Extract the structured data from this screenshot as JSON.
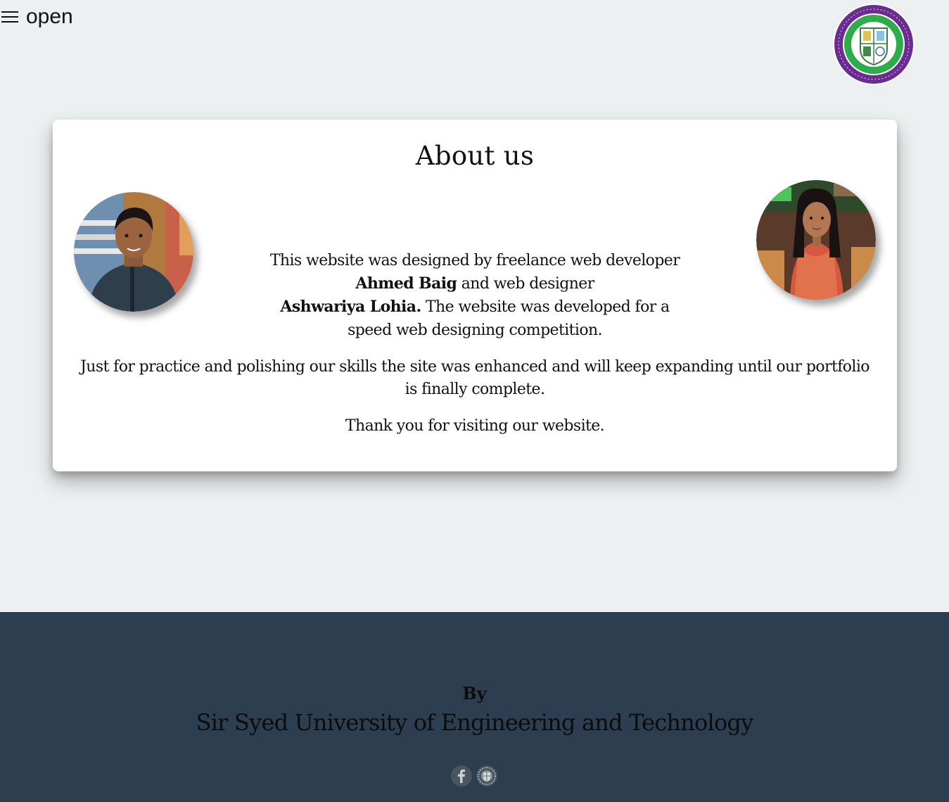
{
  "nav": {
    "toggle_label": "open"
  },
  "about": {
    "title": "About us",
    "intro_1": "This website was designed by freelance web developer",
    "developer_name": "Ahmed Baig",
    "intro_2": "and web designer",
    "designer_name": "Ashwariya Lohia.",
    "intro_3": "The website was developed for a speed web designing competition.",
    "paragraph_2": "Just for practice and polishing our skills the site was enhanced and will keep expanding until our portfolio is finally complete.",
    "paragraph_3": "Thank you for visiting our website."
  },
  "footer": {
    "by_label": "By",
    "university_name": "Sir Syed University of Engineering and Technology",
    "socials": [
      "facebook-icon",
      "university-site-icon"
    ]
  },
  "colors": {
    "page_background": "#ecf0f1",
    "card_background": "#ffffff",
    "footer_background": "#2c3e50",
    "logo_ring": "#6a2c91",
    "logo_inner": "#2eab4a"
  }
}
